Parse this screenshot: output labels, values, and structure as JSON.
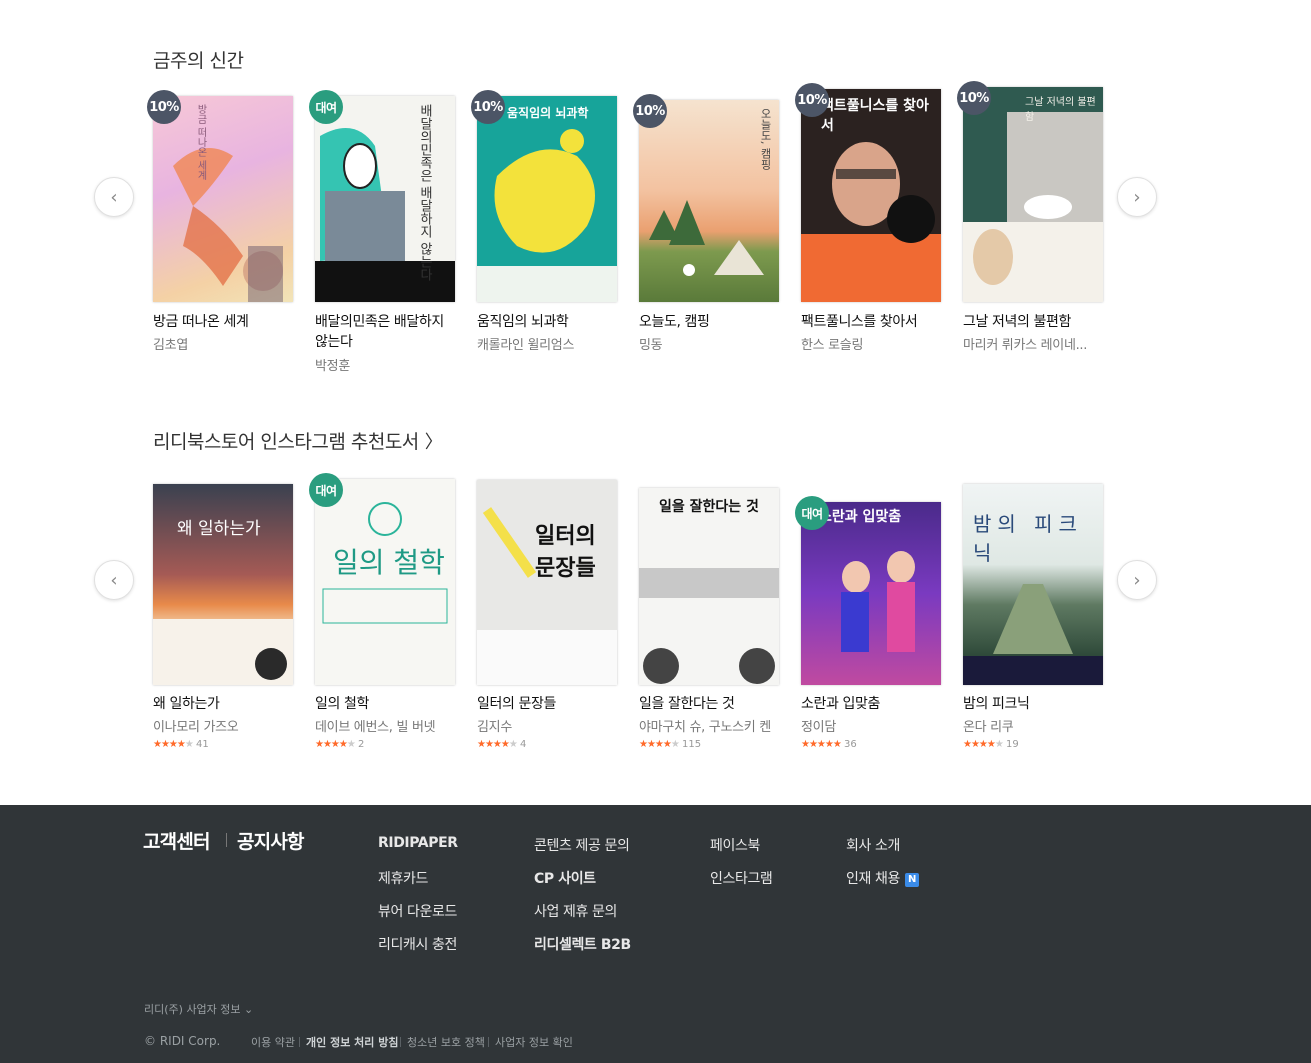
{
  "sections": [
    {
      "title": "금주의 신간",
      "books": [
        {
          "badge": "10%",
          "title": "방금 떠나온 세계",
          "author": "김초엽",
          "cover_text": "방금 떠나온 세계"
        },
        {
          "badge": "대여",
          "title": "배달의민족은 배달하지 않는다",
          "author": "박정훈",
          "cover_text": "배달의민족은 배달하지 않는다"
        },
        {
          "badge": "10%",
          "title": "움직임의 뇌과학",
          "author": "캐롤라인 윌리엄스",
          "cover_text": "움직임의 뇌과학"
        },
        {
          "badge": "10%",
          "title": "오늘도, 캠핑",
          "author": "밍동",
          "cover_text": "오늘도, 캠핑"
        },
        {
          "badge": "10%",
          "title": "팩트풀니스를 찾아서",
          "author": "한스 로슬링",
          "cover_text": "팩트풀니스를 찾아서"
        },
        {
          "badge": "10%",
          "title": "그날 저녁의 불편함",
          "author": "마리커 뤼카스 레이네...",
          "cover_text": "그날 저녁의 불편함"
        }
      ]
    },
    {
      "title": "리디북스토어 인스타그램 추천도서",
      "title_chevron": "〉",
      "books": [
        {
          "badge": "",
          "title": "왜 일하는가",
          "author": "이나모리 가즈오",
          "rating": 4,
          "count": "41",
          "cover_text": "왜 일하는가"
        },
        {
          "badge": "대여",
          "title": "일의 철학",
          "author": "데이브 에번스, 빌 버넷",
          "rating": 4,
          "count": "2",
          "cover_text": "일의 철학"
        },
        {
          "badge": "",
          "title": "일터의 문장들",
          "author": "김지수",
          "rating": 4,
          "count": "4",
          "cover_text": "일터의 문장들"
        },
        {
          "badge": "",
          "title": "일을 잘한다는 것",
          "author": "야마구치 슈, 구노스키 켄",
          "rating": 4.5,
          "count": "115",
          "cover_text": "일을 잘한다는 것"
        },
        {
          "badge": "대여",
          "title": "소란과 입맞춤",
          "author": "정이담",
          "rating": 5,
          "count": "36",
          "cover_text": "소란과 입맞춤"
        },
        {
          "badge": "",
          "title": "밤의 피크닉",
          "author": "온다 리쿠",
          "rating": 4,
          "count": "19",
          "cover_text": "밤의 피크닉"
        }
      ]
    }
  ],
  "nav": {
    "prev_icon": "‹",
    "next_icon": "›"
  },
  "footer": {
    "customer_center": "고객센터",
    "notice": "공지사항",
    "col1": [
      "RIDIPAPER",
      "제휴카드",
      "뷰어 다운로드",
      "리디캐시 충전"
    ],
    "col2": [
      "콘텐츠 제공 문의",
      "CP 사이트",
      "사업 제휴 문의",
      "리디셀렉트 B2B"
    ],
    "col3": [
      "페이스북",
      "인스타그램"
    ],
    "col4": [
      "회사 소개",
      "인재 채용"
    ],
    "new_badge": "N",
    "business_info": "리디(주) 사업자 정보 ⌄",
    "copyright": "© RIDI Corp.",
    "bottom_links": [
      "이용 약관",
      "개인 정보 처리 방침",
      "청소년 보호 정책",
      "사업자 정보 확인"
    ]
  },
  "colors": {
    "sale_badge": "#4c5566",
    "rent_badge": "#2a9d7f",
    "footer_bg": "#303538",
    "star": "#ff6a2a"
  }
}
